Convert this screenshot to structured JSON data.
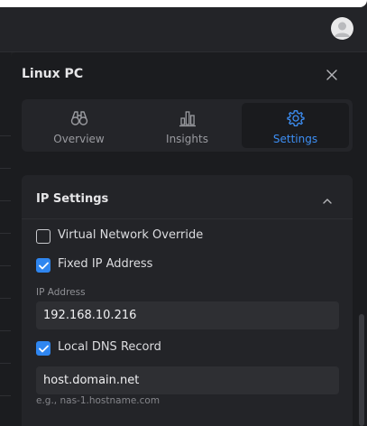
{
  "panel": {
    "title": "Linux PC"
  },
  "tabs": [
    {
      "label": "Overview",
      "icon": "binoculars-icon",
      "active": false
    },
    {
      "label": "Insights",
      "icon": "bar-chart-icon",
      "active": false
    },
    {
      "label": "Settings",
      "icon": "gear-icon",
      "active": true
    }
  ],
  "section": {
    "title": "IP Settings",
    "virtual_override": {
      "label": "Virtual Network Override",
      "checked": false
    },
    "fixed_ip": {
      "label": "Fixed IP Address",
      "checked": true
    },
    "ip_field": {
      "label": "IP Address",
      "value": "192.168.10.216"
    },
    "dns_record": {
      "label": "Local DNS Record",
      "checked": true
    },
    "dns_field": {
      "value": "host.domain.net",
      "hint": "e.g., nas-1.hostname.com"
    }
  },
  "colors": {
    "accent": "#2f86f0",
    "panel_bg": "#1b1c1f",
    "section_bg": "#232428"
  }
}
